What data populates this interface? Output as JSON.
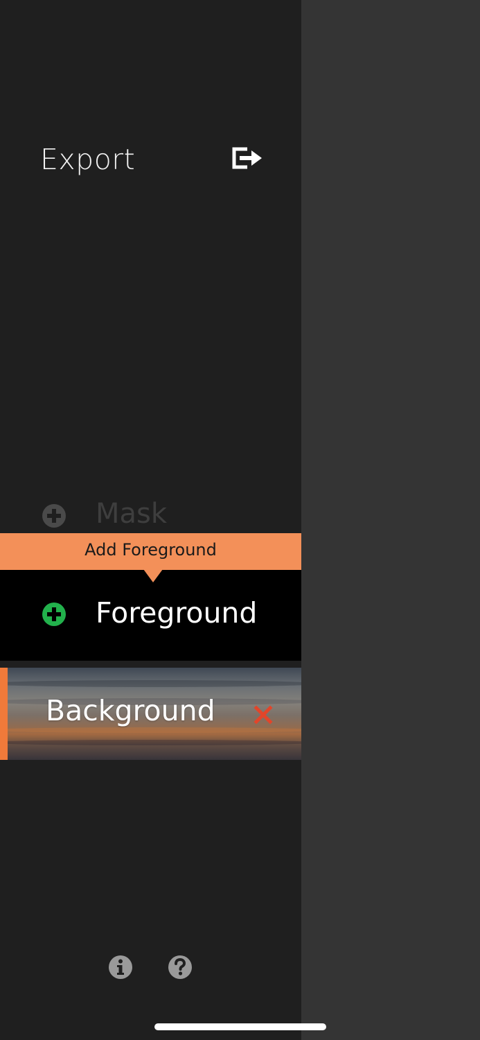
{
  "sidebar": {
    "export_label": "Export",
    "export_icon": "export-icon"
  },
  "layers": {
    "mask_label": "Mask",
    "foreground_label": "Foreground",
    "background_label": "Background",
    "add_icon": "plus-circle-icon",
    "remove_icon": "close-icon"
  },
  "tooltip": {
    "text": "Add Foreground"
  },
  "footer": {
    "info_icon": "info-icon",
    "help_icon": "help-icon"
  },
  "colors": {
    "sidebar_bg": "#1f1f1f",
    "right_pane_bg": "#343434",
    "tooltip_bg": "#f39059",
    "accent_orange": "#f07a3a",
    "add_green": "#22b14c",
    "remove_red": "#e2452a",
    "selected_row_bg": "#000000"
  }
}
